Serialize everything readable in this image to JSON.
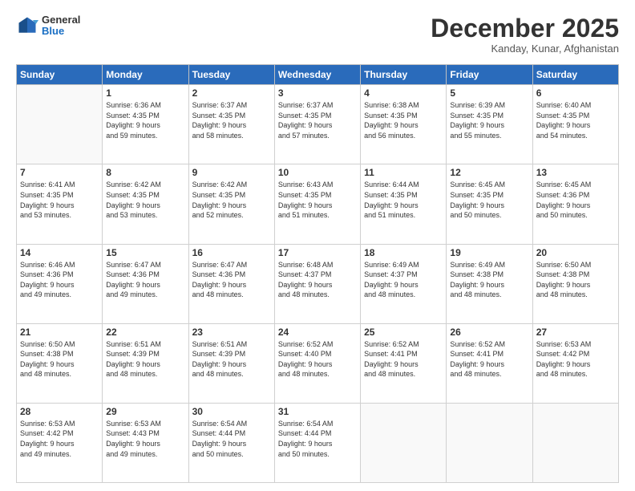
{
  "header": {
    "logo": {
      "general": "General",
      "blue": "Blue"
    },
    "title": "December 2025",
    "subtitle": "Kanday, Kunar, Afghanistan"
  },
  "calendar": {
    "weekdays": [
      "Sunday",
      "Monday",
      "Tuesday",
      "Wednesday",
      "Thursday",
      "Friday",
      "Saturday"
    ],
    "weeks": [
      [
        {
          "day": null,
          "info": null
        },
        {
          "day": "1",
          "info": "Sunrise: 6:36 AM\nSunset: 4:35 PM\nDaylight: 9 hours\nand 59 minutes."
        },
        {
          "day": "2",
          "info": "Sunrise: 6:37 AM\nSunset: 4:35 PM\nDaylight: 9 hours\nand 58 minutes."
        },
        {
          "day": "3",
          "info": "Sunrise: 6:37 AM\nSunset: 4:35 PM\nDaylight: 9 hours\nand 57 minutes."
        },
        {
          "day": "4",
          "info": "Sunrise: 6:38 AM\nSunset: 4:35 PM\nDaylight: 9 hours\nand 56 minutes."
        },
        {
          "day": "5",
          "info": "Sunrise: 6:39 AM\nSunset: 4:35 PM\nDaylight: 9 hours\nand 55 minutes."
        },
        {
          "day": "6",
          "info": "Sunrise: 6:40 AM\nSunset: 4:35 PM\nDaylight: 9 hours\nand 54 minutes."
        }
      ],
      [
        {
          "day": "7",
          "info": "Sunrise: 6:41 AM\nSunset: 4:35 PM\nDaylight: 9 hours\nand 53 minutes."
        },
        {
          "day": "8",
          "info": "Sunrise: 6:42 AM\nSunset: 4:35 PM\nDaylight: 9 hours\nand 53 minutes."
        },
        {
          "day": "9",
          "info": "Sunrise: 6:42 AM\nSunset: 4:35 PM\nDaylight: 9 hours\nand 52 minutes."
        },
        {
          "day": "10",
          "info": "Sunrise: 6:43 AM\nSunset: 4:35 PM\nDaylight: 9 hours\nand 51 minutes."
        },
        {
          "day": "11",
          "info": "Sunrise: 6:44 AM\nSunset: 4:35 PM\nDaylight: 9 hours\nand 51 minutes."
        },
        {
          "day": "12",
          "info": "Sunrise: 6:45 AM\nSunset: 4:35 PM\nDaylight: 9 hours\nand 50 minutes."
        },
        {
          "day": "13",
          "info": "Sunrise: 6:45 AM\nSunset: 4:36 PM\nDaylight: 9 hours\nand 50 minutes."
        }
      ],
      [
        {
          "day": "14",
          "info": "Sunrise: 6:46 AM\nSunset: 4:36 PM\nDaylight: 9 hours\nand 49 minutes."
        },
        {
          "day": "15",
          "info": "Sunrise: 6:47 AM\nSunset: 4:36 PM\nDaylight: 9 hours\nand 49 minutes."
        },
        {
          "day": "16",
          "info": "Sunrise: 6:47 AM\nSunset: 4:36 PM\nDaylight: 9 hours\nand 48 minutes."
        },
        {
          "day": "17",
          "info": "Sunrise: 6:48 AM\nSunset: 4:37 PM\nDaylight: 9 hours\nand 48 minutes."
        },
        {
          "day": "18",
          "info": "Sunrise: 6:49 AM\nSunset: 4:37 PM\nDaylight: 9 hours\nand 48 minutes."
        },
        {
          "day": "19",
          "info": "Sunrise: 6:49 AM\nSunset: 4:38 PM\nDaylight: 9 hours\nand 48 minutes."
        },
        {
          "day": "20",
          "info": "Sunrise: 6:50 AM\nSunset: 4:38 PM\nDaylight: 9 hours\nand 48 minutes."
        }
      ],
      [
        {
          "day": "21",
          "info": "Sunrise: 6:50 AM\nSunset: 4:38 PM\nDaylight: 9 hours\nand 48 minutes."
        },
        {
          "day": "22",
          "info": "Sunrise: 6:51 AM\nSunset: 4:39 PM\nDaylight: 9 hours\nand 48 minutes."
        },
        {
          "day": "23",
          "info": "Sunrise: 6:51 AM\nSunset: 4:39 PM\nDaylight: 9 hours\nand 48 minutes."
        },
        {
          "day": "24",
          "info": "Sunrise: 6:52 AM\nSunset: 4:40 PM\nDaylight: 9 hours\nand 48 minutes."
        },
        {
          "day": "25",
          "info": "Sunrise: 6:52 AM\nSunset: 4:41 PM\nDaylight: 9 hours\nand 48 minutes."
        },
        {
          "day": "26",
          "info": "Sunrise: 6:52 AM\nSunset: 4:41 PM\nDaylight: 9 hours\nand 48 minutes."
        },
        {
          "day": "27",
          "info": "Sunrise: 6:53 AM\nSunset: 4:42 PM\nDaylight: 9 hours\nand 48 minutes."
        }
      ],
      [
        {
          "day": "28",
          "info": "Sunrise: 6:53 AM\nSunset: 4:42 PM\nDaylight: 9 hours\nand 49 minutes."
        },
        {
          "day": "29",
          "info": "Sunrise: 6:53 AM\nSunset: 4:43 PM\nDaylight: 9 hours\nand 49 minutes."
        },
        {
          "day": "30",
          "info": "Sunrise: 6:54 AM\nSunset: 4:44 PM\nDaylight: 9 hours\nand 50 minutes."
        },
        {
          "day": "31",
          "info": "Sunrise: 6:54 AM\nSunset: 4:44 PM\nDaylight: 9 hours\nand 50 minutes."
        },
        {
          "day": null,
          "info": null
        },
        {
          "day": null,
          "info": null
        },
        {
          "day": null,
          "info": null
        }
      ]
    ]
  }
}
